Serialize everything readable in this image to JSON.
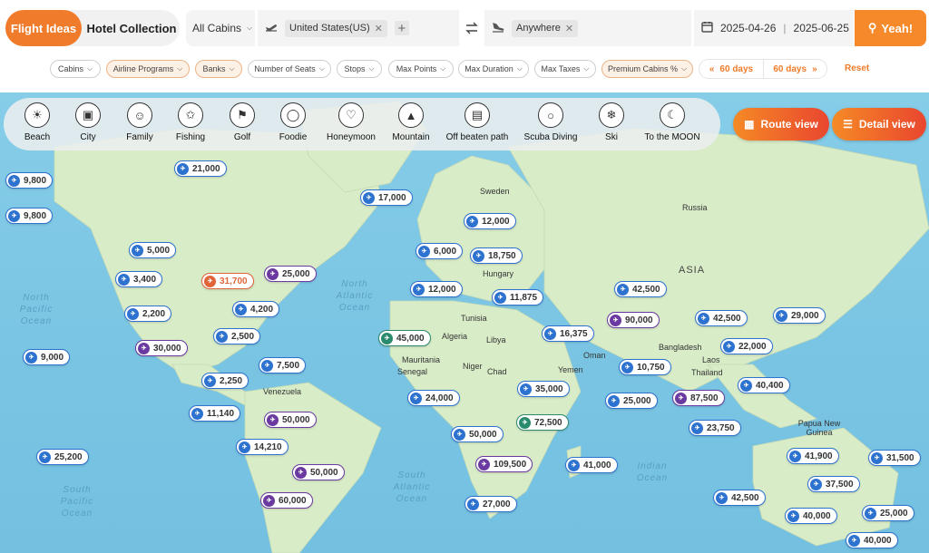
{
  "header": {
    "tabs": [
      {
        "label": "Flight Ideas"
      },
      {
        "label": "Hotel Collection"
      }
    ],
    "cabin": "All Cabins",
    "from": {
      "chip": "United States(US)"
    },
    "to": {
      "chip": "Anywhere"
    },
    "dates": {
      "start": "2025-04-26",
      "end": "2025-06-25"
    },
    "search_label": "Yeah!"
  },
  "filters": {
    "pills": [
      {
        "label": "Cabins"
      },
      {
        "label": "Airline Programs"
      },
      {
        "label": "Banks"
      },
      {
        "label": "Number of Seats"
      },
      {
        "label": "Stops"
      },
      {
        "label": "Max Points"
      },
      {
        "label": "Max Duration"
      },
      {
        "label": "Max Taxes"
      },
      {
        "label": "Premium Cabins %"
      }
    ],
    "days_back": "60 days",
    "days_forward": "60 days",
    "reset": "Reset"
  },
  "categories": [
    {
      "label": "Beach",
      "icon": "beach-icon"
    },
    {
      "label": "City",
      "icon": "city-icon"
    },
    {
      "label": "Family",
      "icon": "family-icon"
    },
    {
      "label": "Fishing",
      "icon": "fishing-icon"
    },
    {
      "label": "Golf",
      "icon": "golf-icon"
    },
    {
      "label": "Foodie",
      "icon": "foodie-icon"
    },
    {
      "label": "Honeymoon",
      "icon": "honeymoon-icon"
    },
    {
      "label": "Mountain",
      "icon": "mountain-icon"
    },
    {
      "label": "Off beaten path",
      "icon": "off-beaten-path-icon"
    },
    {
      "label": "Scuba Diving",
      "icon": "scuba-icon"
    },
    {
      "label": "Ski",
      "icon": "ski-icon"
    },
    {
      "label": "To the MOON",
      "icon": "moon-icon"
    }
  ],
  "views": {
    "route": "Route view",
    "detail": "Detail view"
  },
  "map": {
    "oceans": [
      "North Pacific Ocean",
      "North Atlantic Ocean",
      "South Atlantic Ocean",
      "South Pacific Ocean",
      "Indian Ocean"
    ],
    "places": [
      "Sweden",
      "Russia",
      "ASIA",
      "Hungary",
      "Tunisia",
      "Algeria",
      "Libya",
      "Mauritania",
      "Senegal",
      "Niger",
      "Chad",
      "Oman",
      "Yemen",
      "Bangladesh",
      "Laos",
      "Thailand",
      "Venezuela",
      "Papua New Guinea"
    ],
    "markers": [
      {
        "value": "9,800",
        "color": "blue"
      },
      {
        "value": "21,000",
        "color": "blue"
      },
      {
        "value": "9,800",
        "color": "blue"
      },
      {
        "value": "17,000",
        "color": "blue"
      },
      {
        "value": "12,000",
        "color": "blue"
      },
      {
        "value": "5,000",
        "color": "blue"
      },
      {
        "value": "6,000",
        "color": "blue"
      },
      {
        "value": "18,750",
        "color": "blue"
      },
      {
        "value": "3,400",
        "color": "blue"
      },
      {
        "value": "31,700",
        "color": "red"
      },
      {
        "value": "25,000",
        "color": "purple"
      },
      {
        "value": "12,000",
        "color": "blue"
      },
      {
        "value": "11,875",
        "color": "blue"
      },
      {
        "value": "42,500",
        "color": "blue"
      },
      {
        "value": "2,200",
        "color": "blue"
      },
      {
        "value": "4,200",
        "color": "blue"
      },
      {
        "value": "90,000",
        "color": "purple"
      },
      {
        "value": "42,500",
        "color": "blue"
      },
      {
        "value": "29,000",
        "color": "blue"
      },
      {
        "value": "30,000",
        "color": "purple"
      },
      {
        "value": "2,500",
        "color": "blue"
      },
      {
        "value": "45,000",
        "color": "green"
      },
      {
        "value": "16,375",
        "color": "blue"
      },
      {
        "value": "22,000",
        "color": "blue"
      },
      {
        "value": "9,000",
        "color": "blue"
      },
      {
        "value": "7,500",
        "color": "blue"
      },
      {
        "value": "10,750",
        "color": "blue"
      },
      {
        "value": "2,250",
        "color": "blue"
      },
      {
        "value": "35,000",
        "color": "blue"
      },
      {
        "value": "40,400",
        "color": "blue"
      },
      {
        "value": "24,000",
        "color": "blue"
      },
      {
        "value": "25,000",
        "color": "blue"
      },
      {
        "value": "87,500",
        "color": "purple"
      },
      {
        "value": "11,140",
        "color": "blue"
      },
      {
        "value": "50,000",
        "color": "purple"
      },
      {
        "value": "72,500",
        "color": "green"
      },
      {
        "value": "23,750",
        "color": "blue"
      },
      {
        "value": "50,000",
        "color": "blue"
      },
      {
        "value": "14,210",
        "color": "blue"
      },
      {
        "value": "41,900",
        "color": "blue"
      },
      {
        "value": "25,200",
        "color": "blue"
      },
      {
        "value": "31,500",
        "color": "blue"
      },
      {
        "value": "109,500",
        "color": "purple"
      },
      {
        "value": "41,000",
        "color": "blue"
      },
      {
        "value": "50,000",
        "color": "purple"
      },
      {
        "value": "37,500",
        "color": "blue"
      },
      {
        "value": "60,000",
        "color": "purple"
      },
      {
        "value": "27,000",
        "color": "blue"
      },
      {
        "value": "42,500",
        "color": "blue"
      },
      {
        "value": "40,000",
        "color": "blue"
      },
      {
        "value": "25,000",
        "color": "blue"
      },
      {
        "value": "40,000",
        "color": "blue"
      }
    ]
  },
  "colors": {
    "accent": "#f07c2b",
    "marker_blue": "#2e72d0",
    "marker_purple": "#6a3aa0",
    "marker_green": "#2a8a6e",
    "marker_red": "#e06438",
    "land": "#d8ecc9",
    "water": "#7cc6e4"
  }
}
